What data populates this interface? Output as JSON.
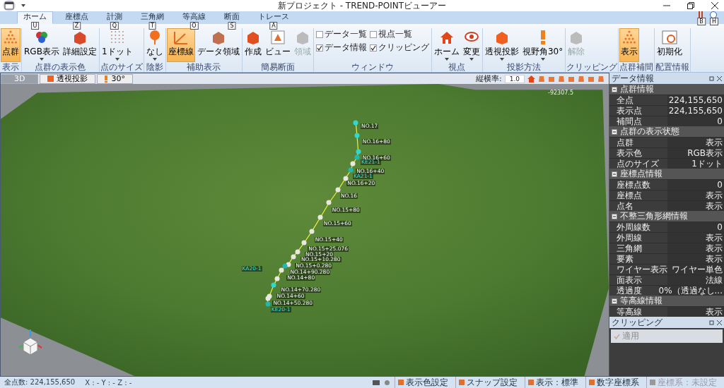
{
  "window": {
    "title": "新プロジェクト - TREND-POINTビューアー",
    "keytips": [
      "B",
      "H"
    ]
  },
  "tabs": [
    {
      "label": "ホーム",
      "key": "U",
      "selected": true
    },
    {
      "label": "座標点",
      "key": "Z",
      "selected": false
    },
    {
      "label": "計測",
      "key": "Q",
      "selected": false
    },
    {
      "label": "三角網",
      "key": "T",
      "selected": false
    },
    {
      "label": "等高線",
      "key": "O",
      "selected": false
    },
    {
      "label": "断面",
      "key": "S",
      "selected": false
    },
    {
      "label": "トレース",
      "key": "A",
      "selected": false
    }
  ],
  "ribbon": [
    {
      "label": "表示",
      "buttons": [
        {
          "label": "点群",
          "selected": true,
          "disabled": false,
          "menu": false
        }
      ]
    },
    {
      "label": "点群の表示色",
      "buttons": [
        {
          "label": "RGB表示",
          "selected": false,
          "disabled": false,
          "menu": true
        },
        {
          "label": "詳細設定",
          "selected": false,
          "disabled": false,
          "menu": false
        }
      ]
    },
    {
      "label": "点のサイズ",
      "buttons": [
        {
          "label": "1ドット",
          "selected": false,
          "disabled": false,
          "menu": true
        }
      ]
    },
    {
      "label": "陰影",
      "buttons": [
        {
          "label": "なし",
          "selected": false,
          "disabled": false,
          "menu": true
        }
      ]
    },
    {
      "label": "補助表示",
      "buttons": [
        {
          "label": "座標線",
          "selected": true,
          "disabled": false,
          "menu": false
        },
        {
          "label": "データ領域",
          "selected": false,
          "disabled": false,
          "menu": false
        }
      ]
    },
    {
      "label": "簡易断面",
      "buttons": [
        {
          "label": "作成",
          "selected": false,
          "disabled": false,
          "menu": false
        },
        {
          "label": "ビュー",
          "selected": false,
          "disabled": false,
          "menu": false
        },
        {
          "label": "領域",
          "selected": false,
          "disabled": true,
          "menu": false
        }
      ]
    },
    {
      "label": "ウィンドウ",
      "checkboxes": [
        {
          "label": "データ一覧",
          "checked": false
        },
        {
          "label": "視点一覧",
          "checked": false
        },
        {
          "label": "データ情報",
          "checked": true
        },
        {
          "label": "クリッピング",
          "checked": true
        }
      ]
    },
    {
      "label": "視点",
      "buttons": [
        {
          "label": "ホーム",
          "selected": false,
          "disabled": false,
          "menu": true
        },
        {
          "label": "変更",
          "selected": false,
          "disabled": false,
          "menu": true
        }
      ]
    },
    {
      "label": "投影方法",
      "buttons": [
        {
          "label": "透視投影",
          "selected": false,
          "disabled": false,
          "menu": true
        },
        {
          "label": "視野角30°",
          "selected": false,
          "disabled": false,
          "menu": true
        }
      ]
    },
    {
      "label": "クリッピング",
      "buttons": [
        {
          "label": "解除",
          "selected": false,
          "disabled": true,
          "menu": false
        }
      ]
    },
    {
      "label": "点群補間",
      "buttons": [
        {
          "label": "表示",
          "selected": true,
          "disabled": false,
          "menu": false
        }
      ]
    },
    {
      "label": "配置情報",
      "buttons": [
        {
          "label": "初期化",
          "selected": false,
          "disabled": false,
          "menu": false
        }
      ]
    }
  ],
  "view_tabs": [
    {
      "label": "3D",
      "selected": true
    },
    {
      "label": "透視投影",
      "selected": false
    },
    {
      "label": "30°",
      "selected": false
    }
  ],
  "view_toolbar": {
    "ratio_label": "縦横率:",
    "ratio_value": "1.0"
  },
  "view": {
    "coordinate": "-92307.5",
    "stations": [
      {
        "label": "NO.17",
        "kind": "station",
        "color": "#30d8d0"
      },
      {
        "label": "NO.16+80",
        "kind": "station",
        "color": "#30d8d0"
      },
      {
        "label": "NO.16+60",
        "kind": "station",
        "color": "#30d8d0"
      },
      {
        "label": "KE21-1",
        "kind": "control",
        "color": "#20b8b0"
      },
      {
        "label": "NO.16+40",
        "kind": "station",
        "color": "#e8e8e0"
      },
      {
        "label": "KA21-1",
        "kind": "control",
        "color": "#20b8b0"
      },
      {
        "label": "NO.16+20",
        "kind": "station",
        "color": "#e8e8e0"
      },
      {
        "label": "NO.16",
        "kind": "station",
        "color": "#e8e8e0"
      },
      {
        "label": "NO.15+80",
        "kind": "station",
        "color": "#e8e8e0"
      },
      {
        "label": "NO.15+60",
        "kind": "station",
        "color": "#e8e8e0"
      },
      {
        "label": "NO.15+40",
        "kind": "station",
        "color": "#e8e8e0"
      },
      {
        "label": "NO.15+25.076",
        "kind": "station",
        "color": "#e8e8e0"
      },
      {
        "label": "NO.15+20",
        "kind": "station",
        "color": "#e8e8e0"
      },
      {
        "label": "NO.15+10.280",
        "kind": "station",
        "color": "#e8e8e0"
      },
      {
        "label": "NO.15+0.280",
        "kind": "station",
        "color": "#e8e8e0"
      },
      {
        "label": "KA20-1",
        "kind": "control",
        "color": "#20b8b0"
      },
      {
        "label": "NO.14+90.280",
        "kind": "station",
        "color": "#e8e8e0"
      },
      {
        "label": "NO.14+80",
        "kind": "station",
        "color": "#e8e8e0"
      },
      {
        "label": "NO.14+70.280",
        "kind": "station",
        "color": "#30d8d0"
      },
      {
        "label": "NO.14+60",
        "kind": "station",
        "color": "#e8e8e0"
      },
      {
        "label": "NO.14+50.280",
        "kind": "station",
        "color": "#e8e8e0"
      },
      {
        "label": "KE20-1",
        "kind": "control",
        "color": "#20b8b0"
      }
    ]
  },
  "data_panel": {
    "title": "データ情報",
    "sections": [
      {
        "title": "点群情報",
        "expanded": true,
        "rows": [
          {
            "name": "全点",
            "value": "224,155,650"
          },
          {
            "name": "表示点",
            "value": "224,155,650"
          },
          {
            "name": "補間点",
            "value": "0"
          }
        ]
      },
      {
        "title": "点群の表示状態",
        "expanded": true,
        "rows": [
          {
            "name": "点群",
            "value": "表示"
          },
          {
            "name": "表示色",
            "value": "RGB表示"
          },
          {
            "name": "点のサイズ",
            "value": "1ドット"
          }
        ]
      },
      {
        "title": "座標点情報",
        "expanded": true,
        "rows": [
          {
            "name": "座標点数",
            "value": "0"
          },
          {
            "name": "座標点",
            "value": "表示"
          },
          {
            "name": "点名",
            "value": "表示"
          }
        ]
      },
      {
        "title": "不整三角形網情報",
        "expanded": true,
        "rows": [
          {
            "name": "外周線数",
            "value": "0"
          },
          {
            "name": "外周線",
            "value": "表示"
          },
          {
            "name": "三角網",
            "value": "表示"
          },
          {
            "name": "要素",
            "value": "表示"
          },
          {
            "name": "ワイヤー表示",
            "value": "ワイヤー単色"
          },
          {
            "name": "面表示",
            "value": "法線"
          },
          {
            "name": "透過度",
            "value": "0%（透過なし..."
          }
        ]
      },
      {
        "title": "等高線情報",
        "expanded": true,
        "rows": [
          {
            "name": "等高線",
            "value": "表示"
          }
        ]
      }
    ]
  },
  "clipping_panel": {
    "title": "クリッピング",
    "apply": {
      "label": "適用",
      "disabled": true
    }
  },
  "status_bar": {
    "left": [
      "全点数: 224,155,650",
      "X : - Y : - Z : -"
    ],
    "right": [
      {
        "label": "表示色設定",
        "disabled": false
      },
      {
        "label": "スナップ設定",
        "disabled": false
      },
      {
        "label": "表示：標準",
        "disabled": false
      },
      {
        "label": "数字座標系",
        "disabled": false
      },
      {
        "label": "座標系：未設定",
        "disabled": true
      }
    ]
  }
}
